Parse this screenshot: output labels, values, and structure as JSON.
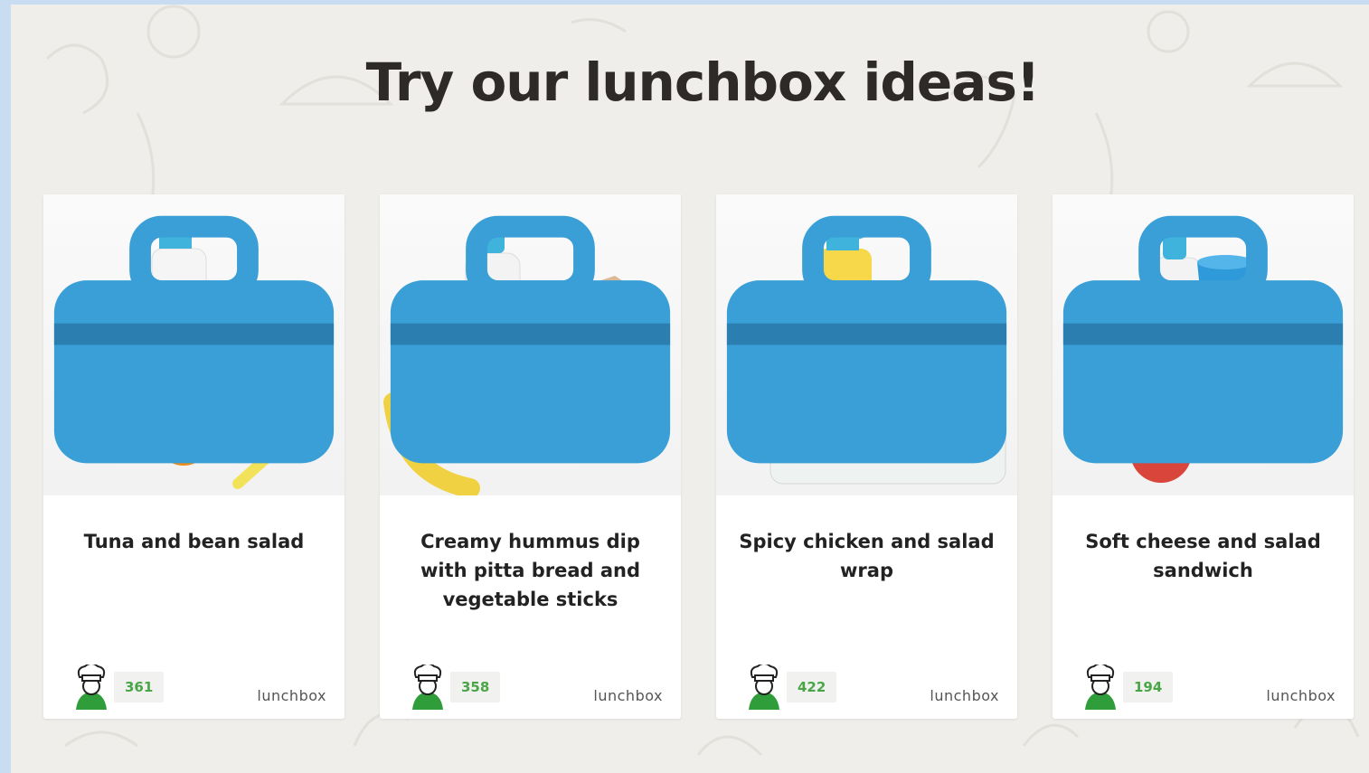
{
  "heading": "Try our lunchbox ideas!",
  "colors": {
    "page_bg": "#efeeea",
    "outer_bg": "#c9ddf2",
    "card_bg": "#ffffff",
    "count_green": "#4aa547",
    "chef_green": "#2f9e3a",
    "lunchbox_blue": "#3a9fd6"
  },
  "icons": {
    "badge": "lunchbox-icon",
    "chef": "chef-hat-icon"
  },
  "cards": [
    {
      "title": "Tuna and bean salad",
      "count": "361",
      "tag": "lunchbox"
    },
    {
      "title": "Creamy hummus dip with pitta bread and vegetable sticks",
      "count": "358",
      "tag": "lunchbox"
    },
    {
      "title": "Spicy chicken and salad wrap",
      "count": "422",
      "tag": "lunchbox"
    },
    {
      "title": "Soft cheese and salad sandwich",
      "count": "194",
      "tag": "lunchbox"
    }
  ]
}
